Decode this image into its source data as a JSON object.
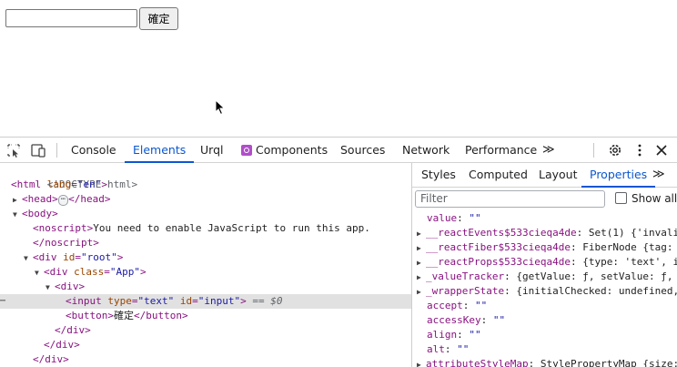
{
  "app": {
    "input_value": "",
    "button_label": "確定"
  },
  "devtools": {
    "tabs": [
      "Console",
      "Elements",
      "Urql",
      "Components",
      "Sources",
      "Network",
      "Performance"
    ],
    "more_tabs": "≫",
    "elements_tree": {
      "doctype": "<!DOCTYPE html>",
      "html_tag": "html",
      "html_attr": "lang",
      "html_val": "\"en\"",
      "head": "head",
      "ellipsis": "⋯",
      "body": "body",
      "noscript_open": "noscript",
      "noscript_text": "You need to enable JavaScript to run this app.",
      "noscript_close": "</noscript>",
      "div": "div",
      "id_attr": "id",
      "root_val": "\"root\"",
      "class_attr": "class",
      "app_val": "\"App\"",
      "input_tag": "input",
      "type_attr": "type",
      "type_val": "\"text\"",
      "input_id_val": "\"input\"",
      "selected_marker": " == $0",
      "button_open": "<button>",
      "button_text": "確定",
      "button_close": "</button>",
      "div_close": "</div>",
      "body_close": "</div>",
      "gutter": "⋯"
    },
    "side_tabs": [
      "Styles",
      "Computed",
      "Layout",
      "Properties"
    ],
    "filter_placeholder": "Filter",
    "show_all_label": "Show all",
    "properties": [
      {
        "key": "value",
        "val": "\"\"",
        "expandable": false
      },
      {
        "key": "__reactEvents$533cieqa4de",
        "val": "Set(1) {'invali",
        "expandable": true
      },
      {
        "key": "__reactFiber$533cieqa4de",
        "val": "FiberNode {tag: ",
        "expandable": true
      },
      {
        "key": "__reactProps$533cieqa4de",
        "val": "{type: 'text', i",
        "expandable": true
      },
      {
        "key": "_valueTracker",
        "val": "{getValue: ƒ, setValue: ƒ,",
        "expandable": true
      },
      {
        "key": "_wrapperState",
        "val": "{initialChecked: undefined,",
        "expandable": true
      },
      {
        "key": "accept",
        "val": "\"\"",
        "expandable": false
      },
      {
        "key": "accessKey",
        "val": "\"\"",
        "expandable": false
      },
      {
        "key": "align",
        "val": "\"\"",
        "expandable": false
      },
      {
        "key": "alt",
        "val": "\"\"",
        "expandable": false
      },
      {
        "key": "attributeStyleMap",
        "val": "StylePropertyMap {size:",
        "expandable": true
      }
    ]
  },
  "colors": {
    "accent": "#0b57d0",
    "tag": "#881280",
    "attr_name": "#994500",
    "attr_value": "#1a1aa6"
  }
}
